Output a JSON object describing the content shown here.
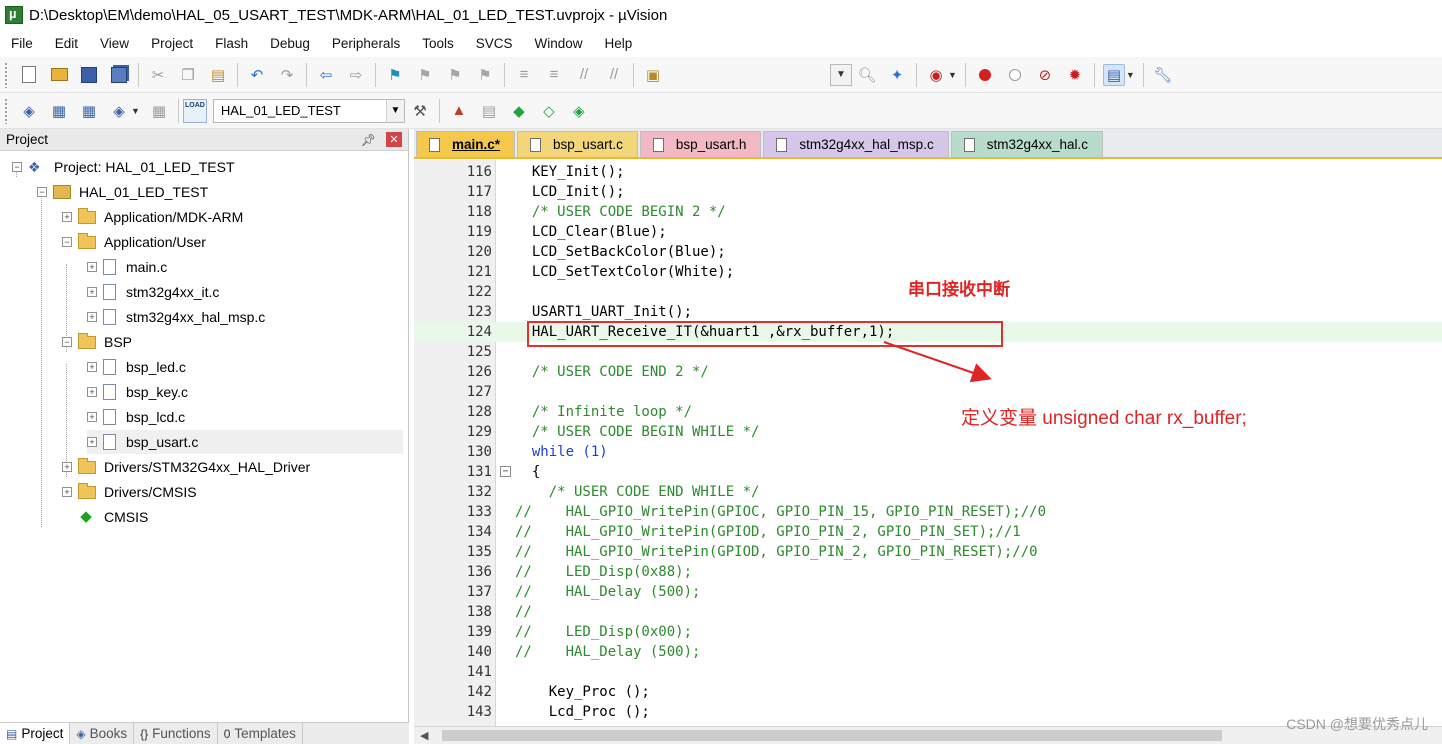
{
  "window": {
    "title": "D:\\Desktop\\EM\\demo\\HAL_05_USART_TEST\\MDK-ARM\\HAL_01_LED_TEST.uvprojx - µVision"
  },
  "menu": [
    "File",
    "Edit",
    "View",
    "Project",
    "Flash",
    "Debug",
    "Peripherals",
    "Tools",
    "SVCS",
    "Window",
    "Help"
  ],
  "toolbar2": {
    "target_name": "HAL_01_LED_TEST",
    "load_label": "LOAD"
  },
  "project_panel": {
    "header": "Project",
    "tree": [
      {
        "label": "Project: HAL_01_LED_TEST",
        "kind": "project"
      },
      {
        "label": "HAL_01_LED_TEST",
        "kind": "target"
      },
      {
        "label": "Application/MDK-ARM",
        "kind": "folder"
      },
      {
        "label": "Application/User",
        "kind": "folder"
      },
      {
        "label": "main.c",
        "kind": "file"
      },
      {
        "label": "stm32g4xx_it.c",
        "kind": "file"
      },
      {
        "label": "stm32g4xx_hal_msp.c",
        "kind": "file"
      },
      {
        "label": "BSP",
        "kind": "folder"
      },
      {
        "label": "bsp_led.c",
        "kind": "file"
      },
      {
        "label": "bsp_key.c",
        "kind": "file"
      },
      {
        "label": "bsp_lcd.c",
        "kind": "file"
      },
      {
        "label": "bsp_usart.c",
        "kind": "file"
      },
      {
        "label": "Drivers/STM32G4xx_HAL_Driver",
        "kind": "folder"
      },
      {
        "label": "Drivers/CMSIS",
        "kind": "folder"
      },
      {
        "label": "CMSIS",
        "kind": "component"
      }
    ],
    "bottom_tabs": [
      "Project",
      "Books",
      "Functions",
      "Templates"
    ]
  },
  "editor": {
    "tabs": [
      "main.c*",
      "bsp_usart.c",
      "bsp_usart.h",
      "stm32g4xx_hal_msp.c",
      "stm32g4xx_hal.c"
    ],
    "active_tab": "main.c*",
    "lines": [
      {
        "n": "116",
        "text": "  KEY_Init();"
      },
      {
        "n": "117",
        "text": "  LCD_Init();"
      },
      {
        "n": "118",
        "text": "  /* USER CODE BEGIN 2 */"
      },
      {
        "n": "119",
        "text": "  LCD_Clear(Blue);"
      },
      {
        "n": "120",
        "text": "  LCD_SetBackColor(Blue);"
      },
      {
        "n": "121",
        "text": "  LCD_SetTextColor(White);"
      },
      {
        "n": "122",
        "text": ""
      },
      {
        "n": "123",
        "text": "  USART1_UART_Init();"
      },
      {
        "n": "124",
        "text": "  HAL_UART_Receive_IT(&huart1 ,&rx_buffer,1);"
      },
      {
        "n": "125",
        "text": ""
      },
      {
        "n": "126",
        "text": "  /* USER CODE END 2 */"
      },
      {
        "n": "127",
        "text": ""
      },
      {
        "n": "128",
        "text": "  /* Infinite loop */"
      },
      {
        "n": "129",
        "text": "  /* USER CODE BEGIN WHILE */"
      },
      {
        "n": "130",
        "text": "  while (1)"
      },
      {
        "n": "131",
        "text": "  {"
      },
      {
        "n": "132",
        "text": "    /* USER CODE END WHILE */"
      },
      {
        "n": "133",
        "text": "//    HAL_GPIO_WritePin(GPIOC, GPIO_PIN_15, GPIO_PIN_RESET);//0"
      },
      {
        "n": "134",
        "text": "//    HAL_GPIO_WritePin(GPIOD, GPIO_PIN_2, GPIO_PIN_SET);//1"
      },
      {
        "n": "135",
        "text": "//    HAL_GPIO_WritePin(GPIOD, GPIO_PIN_2, GPIO_PIN_RESET);//0"
      },
      {
        "n": "136",
        "text": "//    LED_Disp(0x88);"
      },
      {
        "n": "137",
        "text": "//    HAL_Delay (500);"
      },
      {
        "n": "138",
        "text": "//"
      },
      {
        "n": "139",
        "text": "//    LED_Disp(0x00);"
      },
      {
        "n": "140",
        "text": "//    HAL_Delay (500);"
      },
      {
        "n": "141",
        "text": ""
      },
      {
        "n": "142",
        "text": "    Key_Proc ();"
      },
      {
        "n": "143",
        "text": "    Lcd_Proc ();"
      }
    ]
  },
  "annotations": {
    "label1": "串口接收中断",
    "label2": "定义变量 unsigned char rx_buffer;",
    "color": "#e02424"
  },
  "watermark": "CSDN @想要优秀点儿"
}
